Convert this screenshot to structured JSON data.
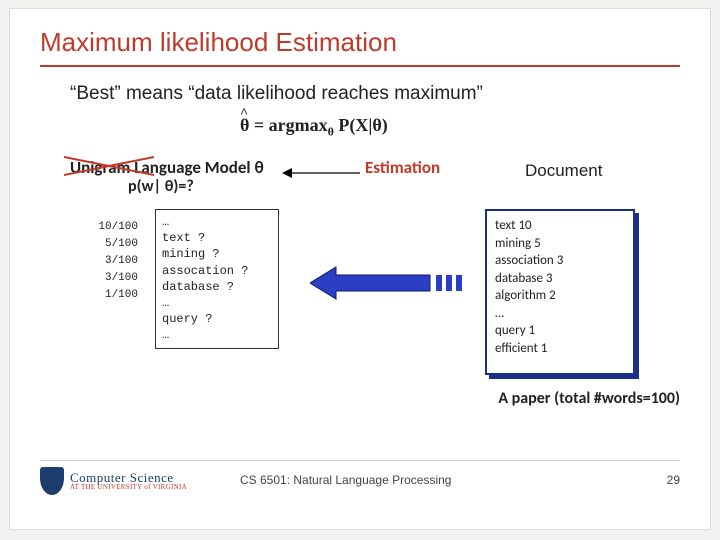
{
  "title": "Maximum likelihood Estimation",
  "subtitle": "“Best” means “data likelihood reaches maximum”",
  "formula": "θ̂ = argmaxθ P(X|θ)",
  "model": {
    "label": "Unigram Language Model  θ",
    "sub": "p(w| θ)=?"
  },
  "estimation_label": "Estimation",
  "document_label": "Document",
  "model_counts": [
    "10/100",
    "5/100",
    "3/100",
    "3/100",
    "",
    "1/100"
  ],
  "model_box_lines": [
    "…",
    "text ?",
    "mining ?",
    "assocation ?",
    "database ?",
    "…",
    "query ?",
    "…"
  ],
  "doc_box_lines": [
    "text 10",
    "mining 5",
    "association 3",
    "database 3",
    "algorithm 2",
    "…",
    "query 1",
    "efficient 1"
  ],
  "caption": "A paper (total #words=100)",
  "footer": {
    "course": "CS 6501: Natural Language Processing",
    "page": "29",
    "logo_big": "Computer Science",
    "logo_small": "AT THE UNIVERSITY of VIRGINIA"
  }
}
